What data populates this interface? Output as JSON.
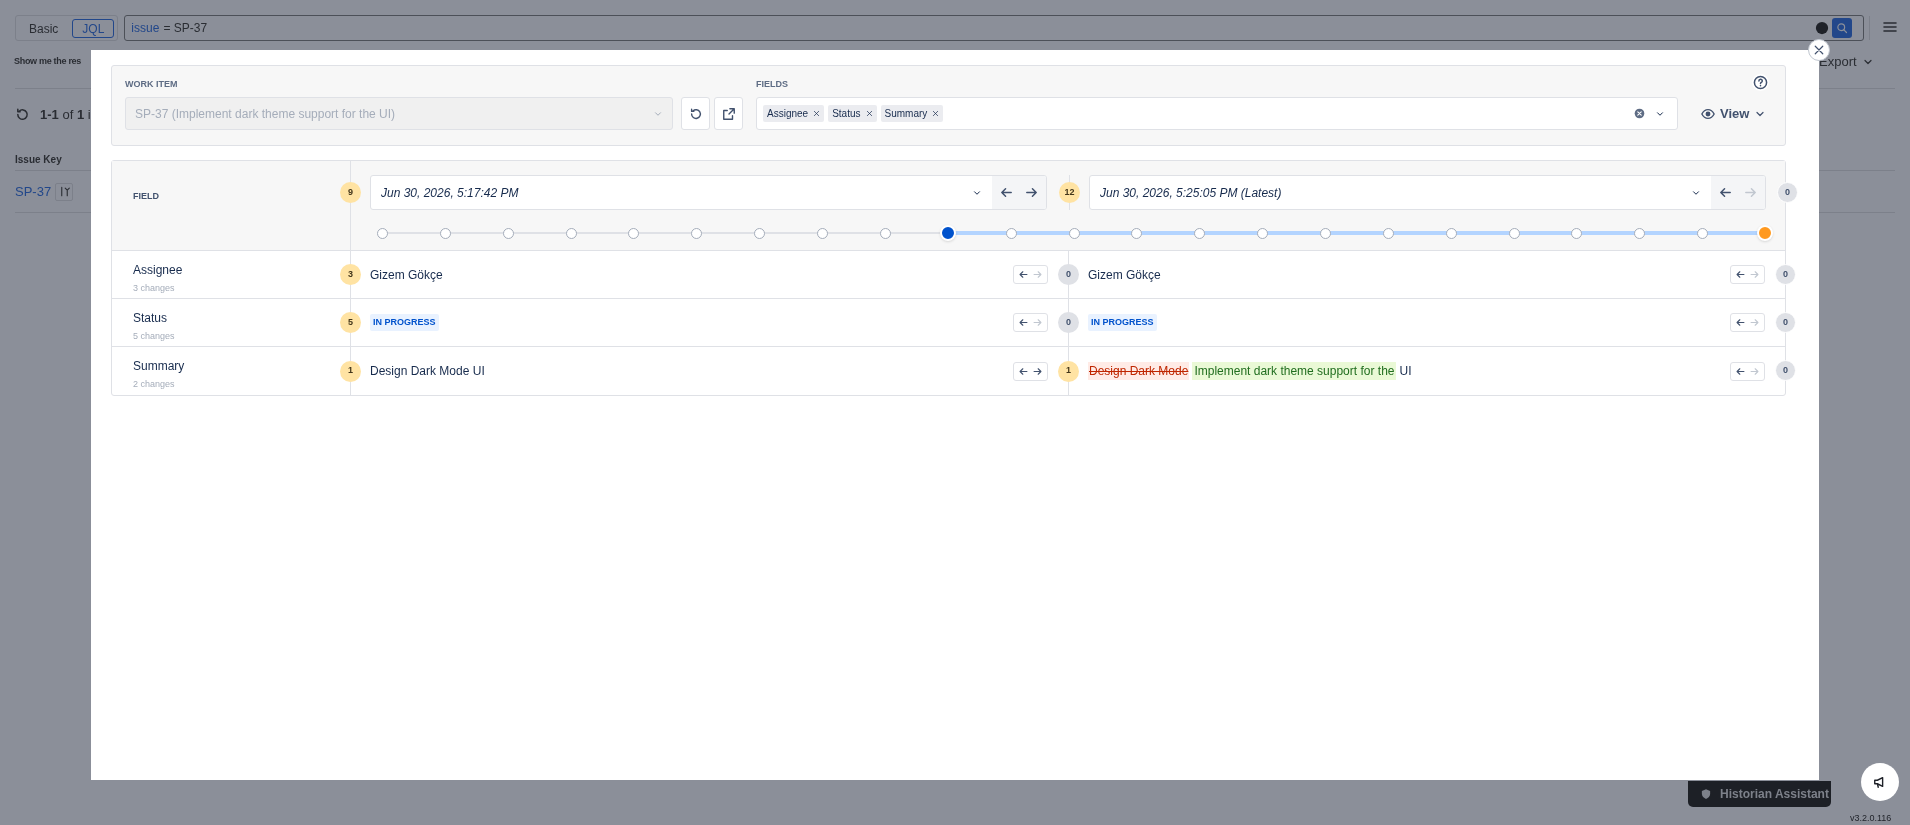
{
  "background": {
    "query_modes": [
      {
        "label": "Basic",
        "selected": false
      },
      {
        "label": "JQL",
        "selected": true
      }
    ],
    "query_tokens": [
      {
        "kind": "keyword",
        "text": "issue"
      },
      {
        "kind": "plain",
        "text": "= SP-37"
      }
    ],
    "hint_text": "Show me the res",
    "result_count": "**1-1** of **1** i",
    "export": "Export",
    "column": "Issue Key",
    "issue_key": "SP-37",
    "assistant": "Historian Assistant",
    "version": "v3.2.0.116"
  },
  "modal": {
    "work_item": {
      "label": "WORK ITEM",
      "value": "SP-37 (Implement dark theme support for the UI)",
      "disabled": true
    },
    "fields": {
      "label": "FIELDS",
      "tags": [
        "Assignee",
        "Status",
        "Summary"
      ]
    },
    "view": "View",
    "compare": {
      "field_header": "FIELD",
      "left": {
        "count": "9",
        "highlight": true,
        "date": "Jun 30, 2026, 5:17:42 PM",
        "prev_enabled": true,
        "next_enabled": true
      },
      "right": {
        "count": "12",
        "highlight": true,
        "date": "Jun 30, 2026, 5:25:05 PM (Latest)",
        "prev_enabled": true,
        "next_enabled": false,
        "trailing_count": "0"
      },
      "timeline": [
        {
          "start": false,
          "end": false
        },
        {
          "start": false,
          "end": false
        },
        {
          "start": false,
          "end": false
        },
        {
          "start": false,
          "end": false
        },
        {
          "start": false,
          "end": false
        },
        {
          "start": false,
          "end": false
        },
        {
          "start": false,
          "end": false
        },
        {
          "start": false,
          "end": false
        },
        {
          "start": false,
          "end": false
        },
        {
          "start": true,
          "end": false
        },
        {
          "start": false,
          "end": false
        },
        {
          "start": false,
          "end": false
        },
        {
          "start": false,
          "end": false
        },
        {
          "start": false,
          "end": false
        },
        {
          "start": false,
          "end": false
        },
        {
          "start": false,
          "end": false
        },
        {
          "start": false,
          "end": false
        },
        {
          "start": false,
          "end": false
        },
        {
          "start": false,
          "end": false
        },
        {
          "start": false,
          "end": false
        },
        {
          "start": false,
          "end": false
        },
        {
          "start": false,
          "end": false
        },
        {
          "start": false,
          "end": true
        }
      ],
      "rows": [
        {
          "label": "Assignee",
          "changes": "3 changes",
          "left": {
            "count": "3",
            "highlight": true,
            "value": [
              {
                "kind": "text",
                "text": "Gizem Gökçe"
              }
            ],
            "prev_enabled": true,
            "next_enabled": false
          },
          "right": {
            "count": "0",
            "highlight": false,
            "value": [
              {
                "kind": "text",
                "text": "Gizem Gökçe"
              }
            ],
            "prev_enabled": true,
            "next_enabled": false,
            "trailing_count": "0"
          }
        },
        {
          "label": "Status",
          "changes": "5 changes",
          "left": {
            "count": "5",
            "highlight": true,
            "value": [
              {
                "kind": "status",
                "text": "IN PROGRESS"
              }
            ],
            "prev_enabled": true,
            "next_enabled": false
          },
          "right": {
            "count": "0",
            "highlight": false,
            "value": [
              {
                "kind": "status",
                "text": "IN PROGRESS"
              }
            ],
            "prev_enabled": true,
            "next_enabled": false,
            "trailing_count": "0"
          }
        },
        {
          "label": "Summary",
          "changes": "2 changes",
          "left": {
            "count": "1",
            "highlight": true,
            "value": [
              {
                "kind": "text",
                "text": "Design Dark Mode UI"
              }
            ],
            "prev_enabled": true,
            "next_enabled": true
          },
          "right": {
            "count": "1",
            "highlight": true,
            "value": [
              {
                "kind": "removed",
                "text": "Design Dark Mode"
              },
              {
                "kind": "added",
                "text": "Implement dark theme support for the"
              },
              {
                "kind": "text",
                "text": "UI"
              }
            ],
            "prev_enabled": true,
            "next_enabled": false,
            "trailing_count": "0"
          }
        }
      ]
    }
  }
}
